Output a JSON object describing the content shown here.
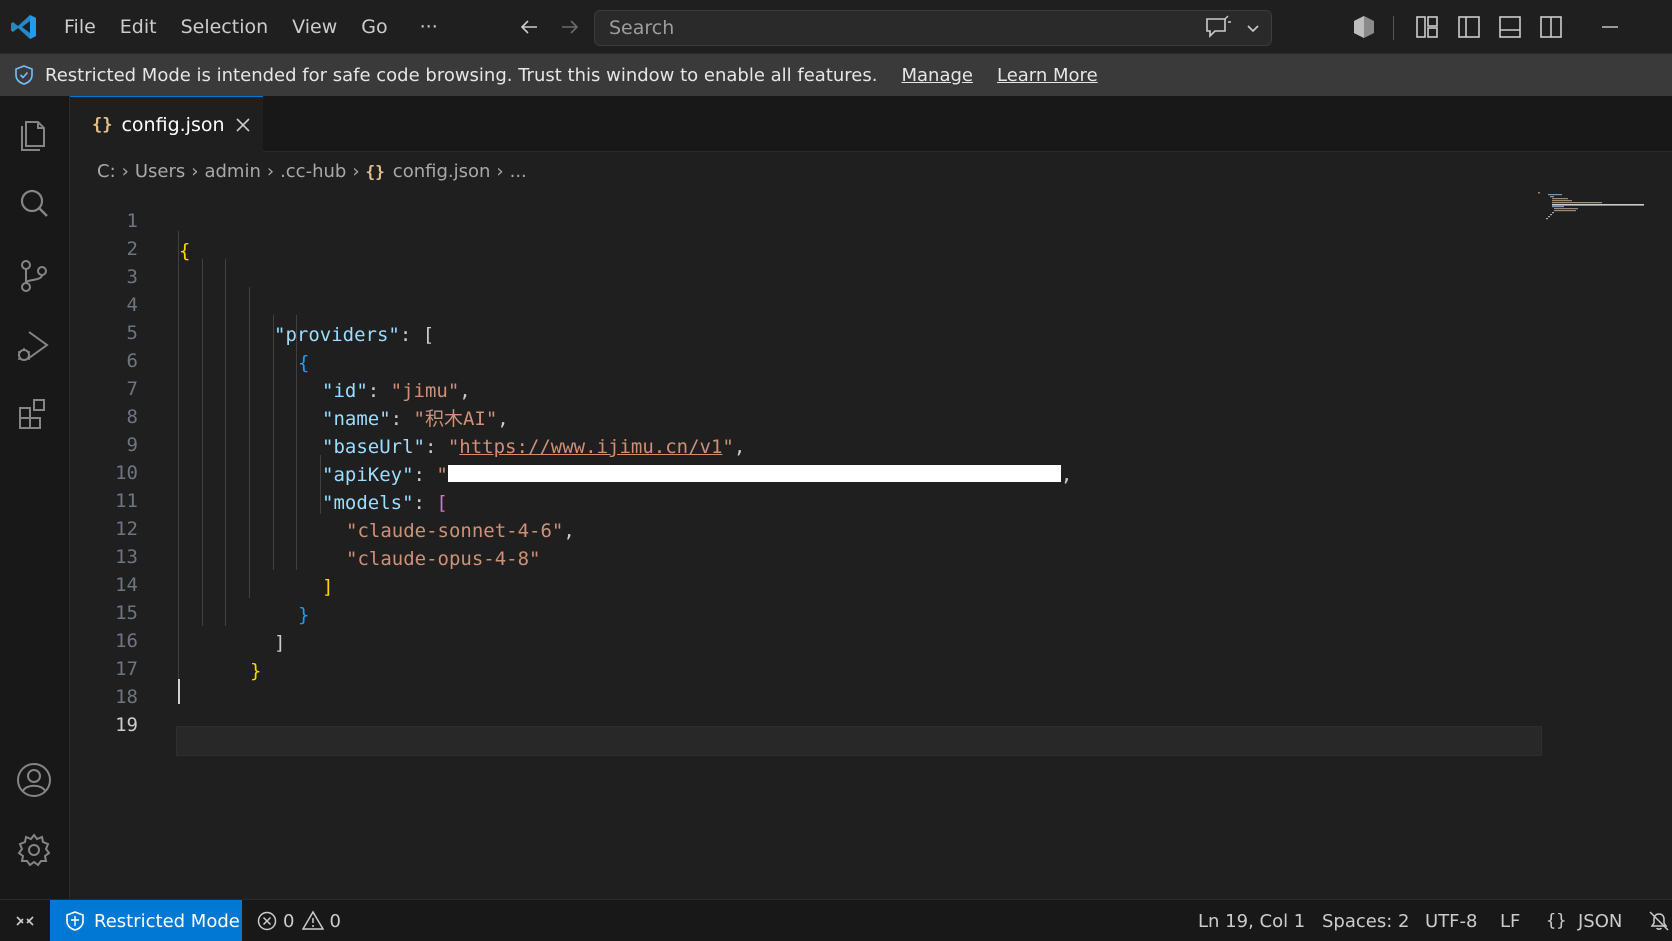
{
  "menu": {
    "items": [
      "File",
      "Edit",
      "Selection",
      "View",
      "Go"
    ],
    "more": "···"
  },
  "search": {
    "placeholder": "Search"
  },
  "banner": {
    "message": "Restricted Mode is intended for safe code browsing. Trust this window to enable all features.",
    "manage": "Manage",
    "learn_more": "Learn More"
  },
  "tab": {
    "icon": "{}",
    "label": "config.json"
  },
  "breadcrumb": {
    "drive": "C:",
    "users": "Users",
    "admin": "admin",
    "folder": ".cc-hub",
    "file_icon": "{}",
    "file": "config.json",
    "more": "..."
  },
  "editor": {
    "line_numbers": [
      "1",
      "2",
      "3",
      "4",
      "5",
      "6",
      "7",
      "8",
      "9",
      "10",
      "11",
      "12",
      "13",
      "14",
      "15",
      "16",
      "17",
      "18",
      "19"
    ],
    "active_line": "19",
    "code": {
      "open_brace": "{",
      "providers_key": "\"providers\"",
      "colon": ": ",
      "open_bracket": "[",
      "obj_open": "{",
      "id_key": "\"id\"",
      "id_val": "\"jimu\"",
      "name_key": "\"name\"",
      "name_val": "\"积木AI\"",
      "baseurl_key": "\"baseUrl\"",
      "quote": "\"",
      "baseurl_val": "https://www.ijimu.cn/v1",
      "apikey_key": "\"apiKey\"",
      "models_key": "\"models\"",
      "model1": "\"claude-sonnet-4-6\"",
      "model2": "\"claude-opus-4-8\"",
      "close_bracket": "]",
      "obj_close": "}",
      "comma": ",",
      "close_brace": "}"
    }
  },
  "statusbar": {
    "restricted": "Restricted Mode",
    "errors": "0",
    "warnings": "0",
    "position": "Ln 19, Col 1",
    "spaces": "Spaces: 2",
    "encoding": "UTF-8",
    "eol": "LF",
    "lang_icon": "{}",
    "language": "JSON"
  },
  "colors": {
    "accent": "#0078d4",
    "background": "#1f1f1f",
    "json_key": "#9cdcfe",
    "json_string": "#ce9178"
  }
}
